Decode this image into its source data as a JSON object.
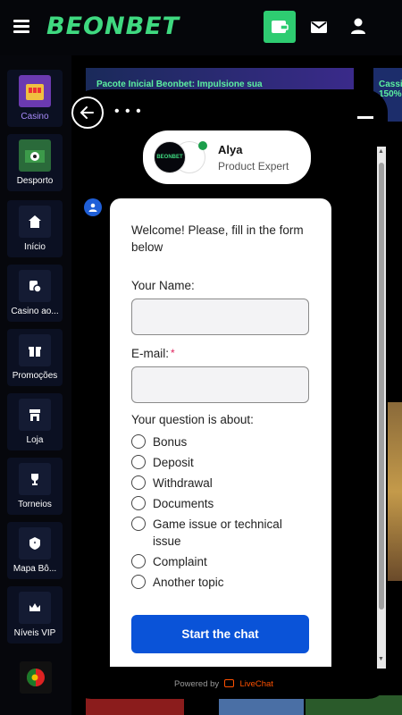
{
  "header": {
    "logo_text": "BEONBET",
    "wallet_icon": "wallet-icon",
    "mail_icon": "mail-icon",
    "user_icon": "user-icon"
  },
  "sidebar": {
    "items": [
      {
        "label": "Casino",
        "icon": "casino-icon",
        "active": true
      },
      {
        "label": "Desporto",
        "icon": "sport-icon"
      },
      {
        "label": "Início",
        "icon": "home-icon"
      },
      {
        "label": "Casino ao...",
        "icon": "live-casino-icon"
      },
      {
        "label": "Promoções",
        "icon": "gift-icon"
      },
      {
        "label": "Loja",
        "icon": "shop-icon"
      },
      {
        "label": "Torneios",
        "icon": "trophy-icon"
      },
      {
        "label": "Mapa Bô...",
        "icon": "bonus-map-icon"
      },
      {
        "label": "Níveis VIP",
        "icon": "crown-icon"
      }
    ],
    "language_flag": "portugal-flag-icon"
  },
  "background": {
    "banner_text": "Pacote Inicial Beonbet: Impulsione sua",
    "banner2_text": "Cassi 150%"
  },
  "chat": {
    "agent": {
      "logo_text": "BEONBET",
      "name": "Alya",
      "role": "Product Expert"
    },
    "form": {
      "welcome": "Welcome! Please, fill in the form below",
      "name_label": "Your Name:",
      "name_value": "",
      "email_label": "E-mail:",
      "email_required": "*",
      "email_value": "",
      "question_label": "Your question is about:",
      "options": [
        "Bonus",
        "Deposit",
        "Withdrawal",
        "Documents",
        "Game issue or technical issue",
        "Complaint",
        "Another topic"
      ],
      "submit_label": "Start the chat"
    },
    "powered_by": "Powered by",
    "brand": "LiveChat"
  },
  "colors": {
    "brand_green": "#3fd980",
    "button_blue": "#0a53d8"
  }
}
